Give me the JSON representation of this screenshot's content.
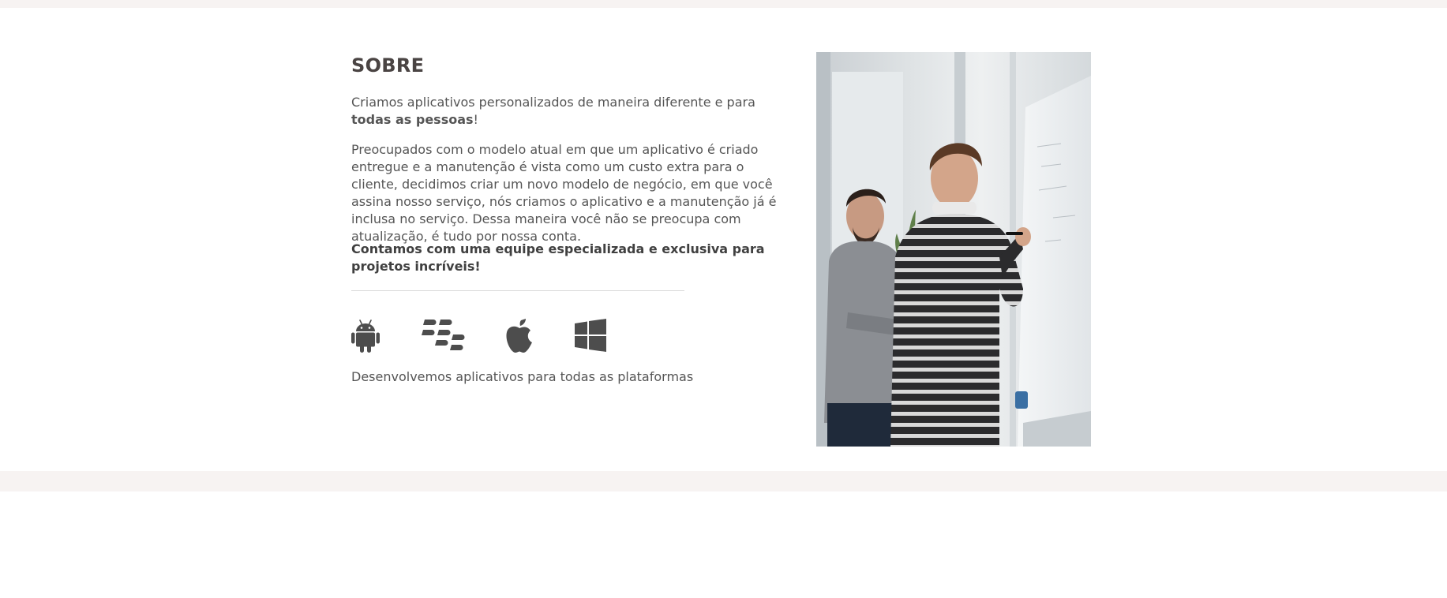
{
  "about": {
    "title": "SOBRE",
    "intro_text": "Criamos aplicativos personalizados de maneira diferente e para ",
    "intro_bold": "todas as pessoas",
    "intro_end": "!",
    "body": "Preocupados com o modelo atual em que um aplicativo é criado entregue e a manutenção é vista como um custo extra para o cliente, decidimos criar um novo modelo de negócio, em que você assina nosso serviço, nós criamos o aplicativo e a manutenção já é inclusa no serviço. Dessa maneira você não se preocupa com atualização, é tudo por nossa conta.",
    "highlight": "Contamos com uma equipe especializada e exclusiva para projetos incríveis!",
    "platforms": [
      {
        "name": "android",
        "icon": "android-icon"
      },
      {
        "name": "blackberry",
        "icon": "blackberry-icon"
      },
      {
        "name": "apple",
        "icon": "apple-icon"
      },
      {
        "name": "windows",
        "icon": "windows-icon"
      }
    ],
    "platforms_caption": "Desenvolvemos aplicativos para todas as plataformas"
  },
  "colors": {
    "strip_background": "#f7f3f2",
    "heading": "#4a4443",
    "text": "#555555",
    "icon": "#4d4d4d"
  }
}
